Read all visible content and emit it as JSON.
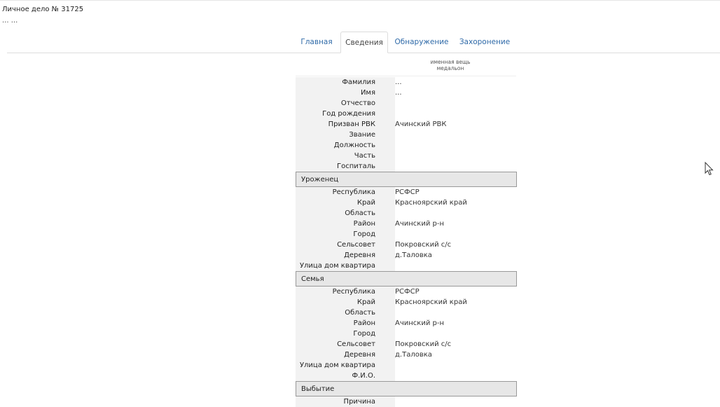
{
  "header": {
    "case_title": "Личное дело № 31725",
    "case_subtitle": "... ..."
  },
  "tabs": [
    {
      "label": "Главная",
      "active": false
    },
    {
      "label": "Сведения",
      "active": true
    },
    {
      "label": "Обнаружение",
      "active": false
    },
    {
      "label": "Захоронение",
      "active": false
    }
  ],
  "medal": {
    "line1": "именная вещь",
    "line2": "медальон"
  },
  "personal": [
    {
      "label": "Фамилия",
      "value": "..."
    },
    {
      "label": "Имя",
      "value": "..."
    },
    {
      "label": "Отчество",
      "value": ""
    },
    {
      "label": "Год рождения",
      "value": ""
    },
    {
      "label": "Призван РВК",
      "value": "Ачинский РВК"
    },
    {
      "label": "Звание",
      "value": ""
    },
    {
      "label": "Должность",
      "value": ""
    },
    {
      "label": "Часть",
      "value": ""
    },
    {
      "label": "Госпиталь",
      "value": ""
    }
  ],
  "native": {
    "title": "Уроженец",
    "rows": [
      {
        "label": "Республика",
        "value": "РСФСР"
      },
      {
        "label": "Край",
        "value": "Красноярский край"
      },
      {
        "label": "Область",
        "value": ""
      },
      {
        "label": "Район",
        "value": "Ачинский р-н"
      },
      {
        "label": "Город",
        "value": ""
      },
      {
        "label": "Сельсовет",
        "value": "Покровский с/с"
      },
      {
        "label": "Деревня",
        "value": "д.Таловка"
      },
      {
        "label": "Улица дом квартира",
        "value": ""
      }
    ]
  },
  "family": {
    "title": "Семья",
    "rows": [
      {
        "label": "Республика",
        "value": "РСФСР"
      },
      {
        "label": "Край",
        "value": "Красноярский край"
      },
      {
        "label": "Область",
        "value": ""
      },
      {
        "label": "Район",
        "value": "Ачинский р-н"
      },
      {
        "label": "Город",
        "value": ""
      },
      {
        "label": "Сельсовет",
        "value": "Покровский с/с"
      },
      {
        "label": "Деревня",
        "value": "д.Таловка"
      },
      {
        "label": "Улица дом квартира",
        "value": ""
      },
      {
        "label": "Ф.И.О.",
        "value": ""
      }
    ]
  },
  "departure": {
    "title": "Выбытие",
    "rows": [
      {
        "label": "Причина",
        "value": ""
      }
    ]
  },
  "cursor": {
    "icon": "mouse-pointer-icon"
  }
}
